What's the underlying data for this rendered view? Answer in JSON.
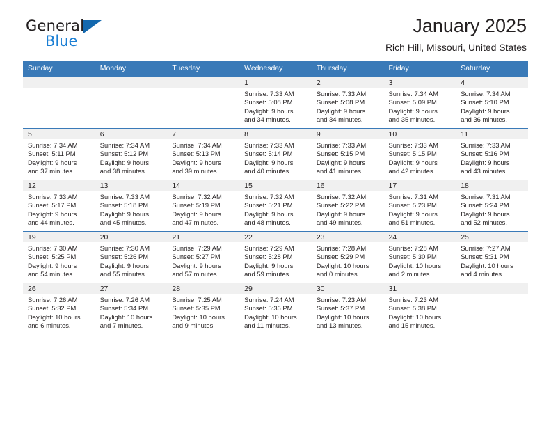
{
  "brand": {
    "name_part1": "General",
    "name_part2": "Blue",
    "logo_icon": "blue-triangle"
  },
  "header": {
    "title": "January 2025",
    "subtitle": "Rich Hill, Missouri, United States"
  },
  "calendar": {
    "weekday_headers": [
      "Sunday",
      "Monday",
      "Tuesday",
      "Wednesday",
      "Thursday",
      "Friday",
      "Saturday"
    ],
    "accent_color": "#3a7ab8",
    "daynum_band_color": "#f0f0f0",
    "weeks": [
      [
        {
          "day": "",
          "lines": []
        },
        {
          "day": "",
          "lines": []
        },
        {
          "day": "",
          "lines": []
        },
        {
          "day": "1",
          "lines": [
            "Sunrise: 7:33 AM",
            "Sunset: 5:08 PM",
            "Daylight: 9 hours",
            "and 34 minutes."
          ]
        },
        {
          "day": "2",
          "lines": [
            "Sunrise: 7:33 AM",
            "Sunset: 5:08 PM",
            "Daylight: 9 hours",
            "and 34 minutes."
          ]
        },
        {
          "day": "3",
          "lines": [
            "Sunrise: 7:34 AM",
            "Sunset: 5:09 PM",
            "Daylight: 9 hours",
            "and 35 minutes."
          ]
        },
        {
          "day": "4",
          "lines": [
            "Sunrise: 7:34 AM",
            "Sunset: 5:10 PM",
            "Daylight: 9 hours",
            "and 36 minutes."
          ]
        }
      ],
      [
        {
          "day": "5",
          "lines": [
            "Sunrise: 7:34 AM",
            "Sunset: 5:11 PM",
            "Daylight: 9 hours",
            "and 37 minutes."
          ]
        },
        {
          "day": "6",
          "lines": [
            "Sunrise: 7:34 AM",
            "Sunset: 5:12 PM",
            "Daylight: 9 hours",
            "and 38 minutes."
          ]
        },
        {
          "day": "7",
          "lines": [
            "Sunrise: 7:34 AM",
            "Sunset: 5:13 PM",
            "Daylight: 9 hours",
            "and 39 minutes."
          ]
        },
        {
          "day": "8",
          "lines": [
            "Sunrise: 7:33 AM",
            "Sunset: 5:14 PM",
            "Daylight: 9 hours",
            "and 40 minutes."
          ]
        },
        {
          "day": "9",
          "lines": [
            "Sunrise: 7:33 AM",
            "Sunset: 5:15 PM",
            "Daylight: 9 hours",
            "and 41 minutes."
          ]
        },
        {
          "day": "10",
          "lines": [
            "Sunrise: 7:33 AM",
            "Sunset: 5:15 PM",
            "Daylight: 9 hours",
            "and 42 minutes."
          ]
        },
        {
          "day": "11",
          "lines": [
            "Sunrise: 7:33 AM",
            "Sunset: 5:16 PM",
            "Daylight: 9 hours",
            "and 43 minutes."
          ]
        }
      ],
      [
        {
          "day": "12",
          "lines": [
            "Sunrise: 7:33 AM",
            "Sunset: 5:17 PM",
            "Daylight: 9 hours",
            "and 44 minutes."
          ]
        },
        {
          "day": "13",
          "lines": [
            "Sunrise: 7:33 AM",
            "Sunset: 5:18 PM",
            "Daylight: 9 hours",
            "and 45 minutes."
          ]
        },
        {
          "day": "14",
          "lines": [
            "Sunrise: 7:32 AM",
            "Sunset: 5:19 PM",
            "Daylight: 9 hours",
            "and 47 minutes."
          ]
        },
        {
          "day": "15",
          "lines": [
            "Sunrise: 7:32 AM",
            "Sunset: 5:21 PM",
            "Daylight: 9 hours",
            "and 48 minutes."
          ]
        },
        {
          "day": "16",
          "lines": [
            "Sunrise: 7:32 AM",
            "Sunset: 5:22 PM",
            "Daylight: 9 hours",
            "and 49 minutes."
          ]
        },
        {
          "day": "17",
          "lines": [
            "Sunrise: 7:31 AM",
            "Sunset: 5:23 PM",
            "Daylight: 9 hours",
            "and 51 minutes."
          ]
        },
        {
          "day": "18",
          "lines": [
            "Sunrise: 7:31 AM",
            "Sunset: 5:24 PM",
            "Daylight: 9 hours",
            "and 52 minutes."
          ]
        }
      ],
      [
        {
          "day": "19",
          "lines": [
            "Sunrise: 7:30 AM",
            "Sunset: 5:25 PM",
            "Daylight: 9 hours",
            "and 54 minutes."
          ]
        },
        {
          "day": "20",
          "lines": [
            "Sunrise: 7:30 AM",
            "Sunset: 5:26 PM",
            "Daylight: 9 hours",
            "and 55 minutes."
          ]
        },
        {
          "day": "21",
          "lines": [
            "Sunrise: 7:29 AM",
            "Sunset: 5:27 PM",
            "Daylight: 9 hours",
            "and 57 minutes."
          ]
        },
        {
          "day": "22",
          "lines": [
            "Sunrise: 7:29 AM",
            "Sunset: 5:28 PM",
            "Daylight: 9 hours",
            "and 59 minutes."
          ]
        },
        {
          "day": "23",
          "lines": [
            "Sunrise: 7:28 AM",
            "Sunset: 5:29 PM",
            "Daylight: 10 hours",
            "and 0 minutes."
          ]
        },
        {
          "day": "24",
          "lines": [
            "Sunrise: 7:28 AM",
            "Sunset: 5:30 PM",
            "Daylight: 10 hours",
            "and 2 minutes."
          ]
        },
        {
          "day": "25",
          "lines": [
            "Sunrise: 7:27 AM",
            "Sunset: 5:31 PM",
            "Daylight: 10 hours",
            "and 4 minutes."
          ]
        }
      ],
      [
        {
          "day": "26",
          "lines": [
            "Sunrise: 7:26 AM",
            "Sunset: 5:32 PM",
            "Daylight: 10 hours",
            "and 6 minutes."
          ]
        },
        {
          "day": "27",
          "lines": [
            "Sunrise: 7:26 AM",
            "Sunset: 5:34 PM",
            "Daylight: 10 hours",
            "and 7 minutes."
          ]
        },
        {
          "day": "28",
          "lines": [
            "Sunrise: 7:25 AM",
            "Sunset: 5:35 PM",
            "Daylight: 10 hours",
            "and 9 minutes."
          ]
        },
        {
          "day": "29",
          "lines": [
            "Sunrise: 7:24 AM",
            "Sunset: 5:36 PM",
            "Daylight: 10 hours",
            "and 11 minutes."
          ]
        },
        {
          "day": "30",
          "lines": [
            "Sunrise: 7:23 AM",
            "Sunset: 5:37 PM",
            "Daylight: 10 hours",
            "and 13 minutes."
          ]
        },
        {
          "day": "31",
          "lines": [
            "Sunrise: 7:23 AM",
            "Sunset: 5:38 PM",
            "Daylight: 10 hours",
            "and 15 minutes."
          ]
        },
        {
          "day": "",
          "lines": []
        }
      ]
    ]
  }
}
